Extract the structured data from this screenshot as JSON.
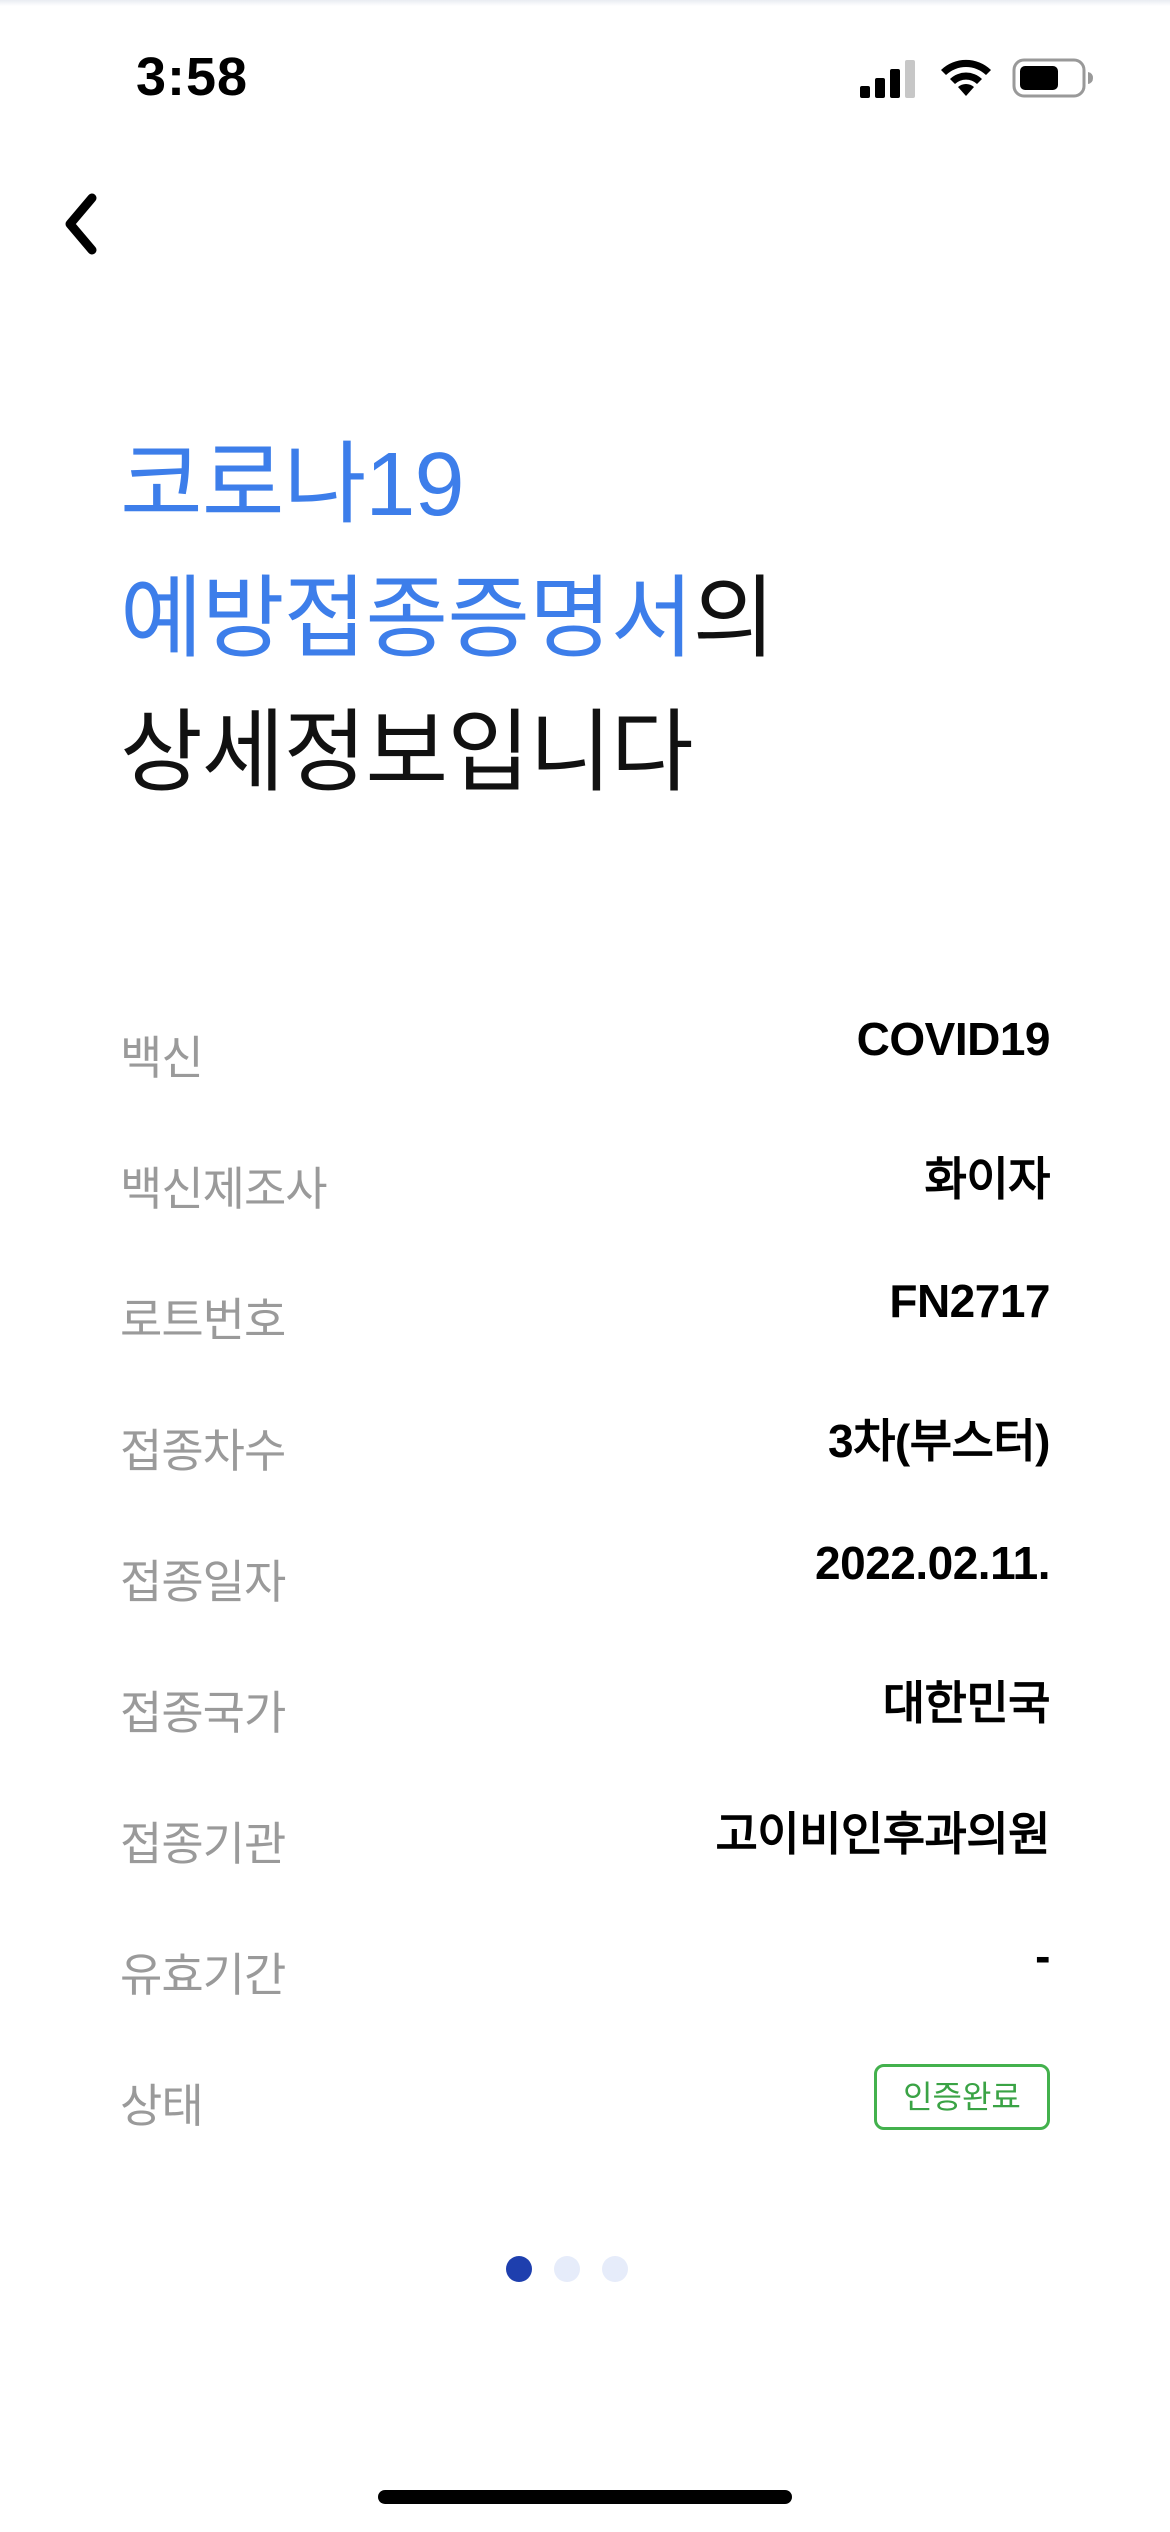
{
  "status_bar": {
    "time": "3:58",
    "icons": [
      "cellular-signal-icon",
      "wifi-icon",
      "battery-icon"
    ]
  },
  "navigation": {
    "back_icon": "chevron-left-icon"
  },
  "title": {
    "line1_blue": "코로나19",
    "line2_blue": "예방접종증명서",
    "line2_black": "의",
    "line3_black": "상세정보입니다"
  },
  "details": {
    "vaccine": {
      "label": "백신",
      "value": "COVID19"
    },
    "manufacturer": {
      "label": "백신제조사",
      "value": "화이자"
    },
    "lot_number": {
      "label": "로트번호",
      "value": "FN2717"
    },
    "dose": {
      "label": "접종차수",
      "value": "3차(부스터)"
    },
    "date": {
      "label": "접종일자",
      "value": "2022.02.11."
    },
    "country": {
      "label": "접종국가",
      "value": "대한민국"
    },
    "institution": {
      "label": "접종기관",
      "value": "고이비인후과의원"
    },
    "validity": {
      "label": "유효기간",
      "value": "-"
    },
    "status": {
      "label": "상태",
      "value": "인증완료"
    }
  },
  "pagination": {
    "total_pages": 3,
    "current_page": 1
  },
  "colors": {
    "title_blue": "#3d7eea",
    "label_gray": "#9a9a9a",
    "badge_green": "#43b14d",
    "active_dot": "#1e3fae",
    "inactive_dot": "#e6ecfa"
  }
}
